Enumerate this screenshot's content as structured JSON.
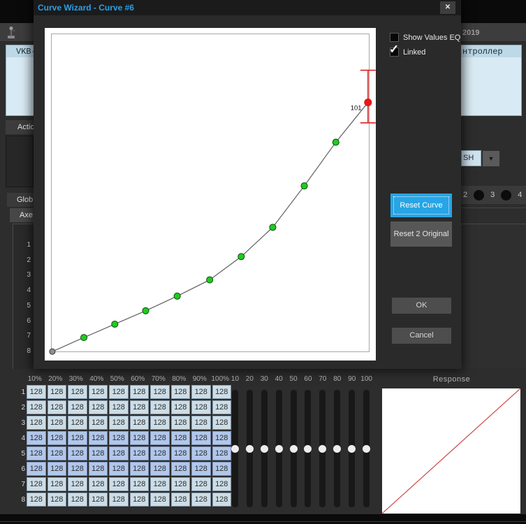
{
  "window": {
    "year_text": "2019",
    "device_list": {
      "left_text": "VKB-",
      "right_text": "нтроллер"
    },
    "left_panel": {
      "action_label": "Actio",
      "global_tab": "Glob",
      "axes_tab": "Axe",
      "axis_rows": [
        "1",
        "2",
        "3",
        "4",
        "5",
        "6",
        "7",
        "8"
      ]
    },
    "combo": {
      "value": "SH",
      "arrow": "▼"
    },
    "port_indicators": [
      "2",
      "3",
      "4"
    ]
  },
  "dialog": {
    "title": "Curve Wizard - Curve #6",
    "close_label": "✕",
    "checkboxes": [
      {
        "label": "Show Values EQ",
        "checked": false
      },
      {
        "label": "Linked",
        "checked": true
      }
    ],
    "check_glyph": "✓",
    "buttons": {
      "reset_curve": "Reset Curve",
      "reset_original": "Reset 2 Original",
      "ok": "OK",
      "cancel": "Cancel"
    }
  },
  "chart_data": [
    {
      "type": "line",
      "title": "Curve Wizard editor curve",
      "x_range": [
        0,
        100
      ],
      "y_range": [
        0,
        100
      ],
      "grid": false,
      "points": [
        [
          0.2,
          0.4
        ],
        [
          10.1,
          4.8
        ],
        [
          19.8,
          9.0
        ],
        [
          29.5,
          13.2
        ],
        [
          39.4,
          17.8
        ],
        [
          49.6,
          22.9
        ],
        [
          59.5,
          30.2
        ],
        [
          69.4,
          39.4
        ],
        [
          79.3,
          52.4
        ],
        [
          89.2,
          66.1
        ],
        [
          99.3,
          78.6
        ]
      ],
      "line_color": "#606060",
      "point_color": "#1fcc1f",
      "point_stroke": "#0d4d0d",
      "start_point_color": "#909090",
      "selected_point": {
        "x": 99.3,
        "y": 78.6,
        "label": "101",
        "color": "#e81818"
      },
      "selected_errorbar": {
        "above": 10.1,
        "below": 6.4,
        "cap_half": 2.4,
        "color": "#e02020"
      }
    },
    {
      "type": "line",
      "title": "Response",
      "x_range": [
        0,
        100
      ],
      "y_range": [
        0,
        100
      ],
      "grid": false,
      "points": [
        [
          0,
          0
        ],
        [
          100,
          100
        ]
      ],
      "line_color": "#cc4646"
    }
  ],
  "table": {
    "col_headers": [
      "10%",
      "20%",
      "30%",
      "40%",
      "50%",
      "60%",
      "70%",
      "80%",
      "90%",
      "100%"
    ],
    "rows": [
      {
        "label": "1",
        "highlight": false,
        "values": [
          "128",
          "128",
          "128",
          "128",
          "128",
          "128",
          "128",
          "128",
          "128",
          "128"
        ]
      },
      {
        "label": "2",
        "highlight": false,
        "values": [
          "128",
          "128",
          "128",
          "128",
          "128",
          "128",
          "128",
          "128",
          "128",
          "128"
        ]
      },
      {
        "label": "3",
        "highlight": false,
        "values": [
          "128",
          "128",
          "128",
          "128",
          "128",
          "128",
          "128",
          "128",
          "128",
          "128"
        ]
      },
      {
        "label": "4",
        "highlight": true,
        "values": [
          "128",
          "128",
          "128",
          "128",
          "128",
          "128",
          "128",
          "128",
          "128",
          "128"
        ]
      },
      {
        "label": "5",
        "highlight": true,
        "values": [
          "128",
          "128",
          "128",
          "128",
          "128",
          "128",
          "128",
          "128",
          "128",
          "128"
        ]
      },
      {
        "label": "6",
        "highlight": true,
        "values": [
          "128",
          "128",
          "128",
          "128",
          "128",
          "128",
          "128",
          "128",
          "128",
          "128"
        ]
      },
      {
        "label": "7",
        "highlight": false,
        "values": [
          "128",
          "128",
          "128",
          "128",
          "128",
          "128",
          "128",
          "128",
          "128",
          "128"
        ]
      },
      {
        "label": "8",
        "highlight": false,
        "values": [
          "128",
          "128",
          "128",
          "128",
          "128",
          "128",
          "128",
          "128",
          "128",
          "128"
        ]
      }
    ]
  },
  "sliders": {
    "labels": [
      "10",
      "20",
      "30",
      "40",
      "50",
      "60",
      "70",
      "80",
      "90",
      "100"
    ],
    "value_pct": 50
  },
  "response": {
    "title": "Response"
  }
}
